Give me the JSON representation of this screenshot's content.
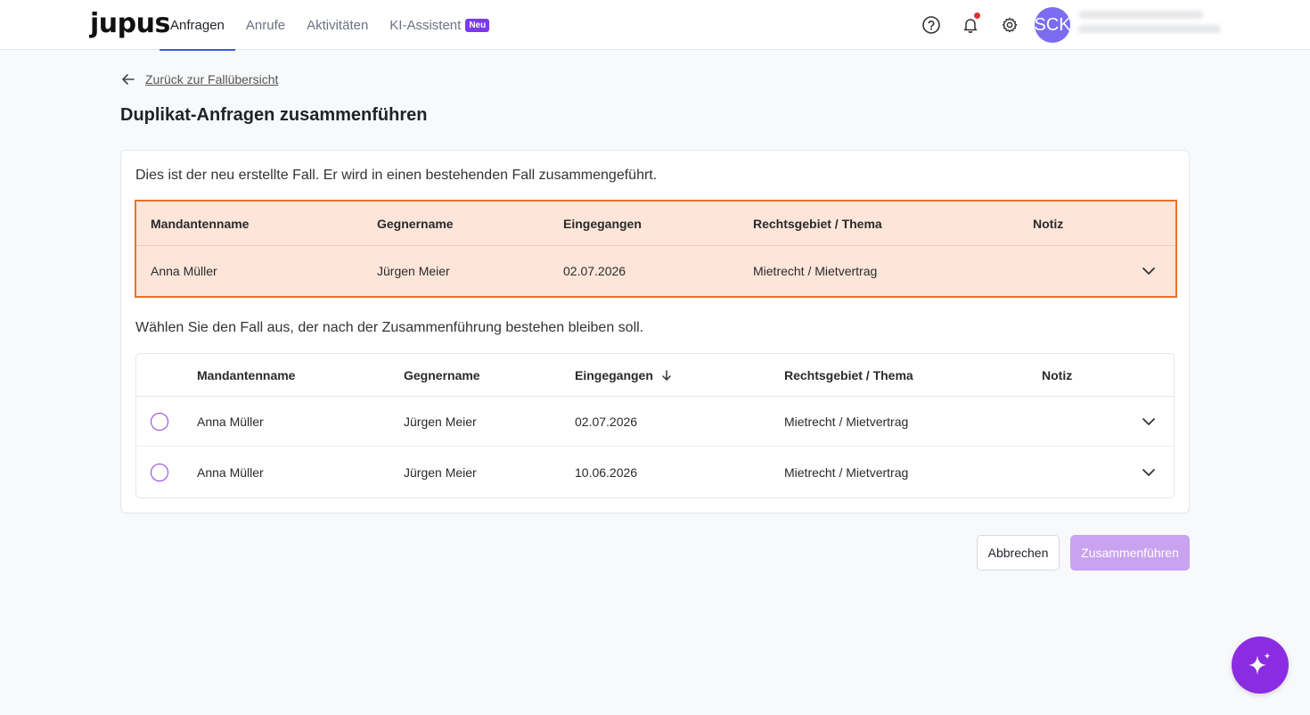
{
  "header": {
    "logo": "jupus",
    "nav": [
      {
        "label": "Anfragen",
        "active": true
      },
      {
        "label": "Anrufe",
        "active": false
      },
      {
        "label": "Aktivitäten",
        "active": false
      },
      {
        "label": "KI-Assistent",
        "active": false,
        "badge": "Neu"
      }
    ],
    "icons": [
      "help-icon",
      "bell-icon",
      "gear-icon"
    ],
    "avatar_initials": "SCK"
  },
  "back_link": "Zurück zur Fallübersicht",
  "page_title": "Duplikat-Anfragen zusammenführen",
  "new_case": {
    "description": "Dies ist der neu erstellte Fall. Er wird in einen bestehenden Fall zusammengeführt.",
    "columns": [
      "Mandantenname",
      "Gegnername",
      "Eingegangen",
      "Rechtsgebiet / Thema",
      "Notiz"
    ],
    "row": {
      "client": "Anna Müller",
      "opponent": "Jürgen Meier",
      "received": "02.07.2026",
      "area": "Mietrecht / Mietvertrag",
      "note": ""
    }
  },
  "select": {
    "description": "Wählen Sie den Fall aus, der nach der Zusammenführung bestehen bleiben soll.",
    "columns": [
      "Mandantenname",
      "Gegnername",
      "Eingegangen",
      "Rechtsgebiet / Thema",
      "Notiz"
    ],
    "sort_column": "Eingegangen",
    "sort_direction": "desc",
    "rows": [
      {
        "client": "Anna Müller",
        "opponent": "Jürgen Meier",
        "received": "02.07.2026",
        "area": "Mietrecht / Mietvertrag",
        "note": "",
        "selected": false
      },
      {
        "client": "Anna Müller",
        "opponent": "Jürgen Meier",
        "received": "10.06.2026",
        "area": "Mietrecht / Mietvertrag",
        "note": "",
        "selected": false
      }
    ]
  },
  "actions": {
    "cancel": "Abbrechen",
    "merge": "Zusammenführen",
    "merge_disabled": true
  },
  "colors": {
    "accent": "#8b2be2",
    "highlight_bg": "#fde5da",
    "highlight_border": "#e8722c",
    "nav_active": "#3b5bdb"
  }
}
